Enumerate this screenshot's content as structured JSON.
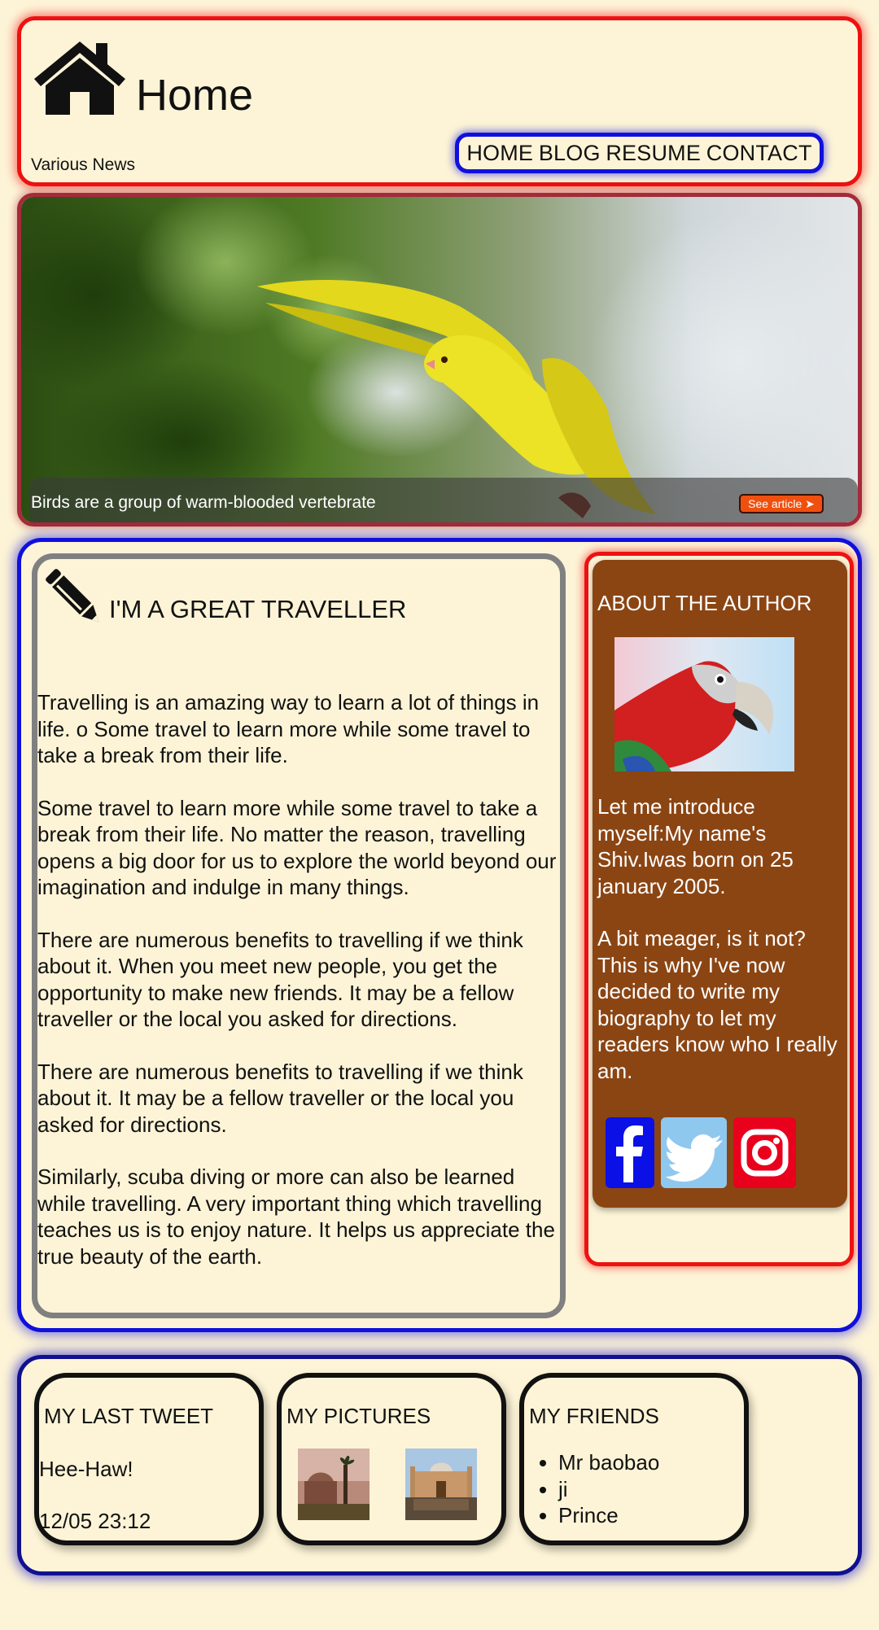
{
  "header": {
    "title": "Home",
    "subtitle": "Various News",
    "nav": [
      "HOME",
      "BLOG",
      "RESUME",
      "CONTACT"
    ]
  },
  "hero": {
    "caption": "Birds are a group of warm-blooded vertebrate",
    "button_label": "See article ➤"
  },
  "article": {
    "title": "I'M A GREAT TRAVELLER",
    "paragraphs": [
      "Travelling is an amazing way to learn a lot of things in life. o Some travel to learn more while some travel to take a break from their life.",
      "Some travel to learn more while some travel to take a break from their life. No matter the reason, travelling opens a big door for us to explore the world beyond our imagination and indulge in many things.",
      "There are numerous benefits to travelling if we think about it. When you meet new people, you get the opportunity to make new friends. It may be a fellow traveller or the local you asked for directions.",
      "There are numerous benefits to travelling if we think about it. It may be a fellow traveller or the local you asked for directions.",
      "Similarly, scuba diving or more can also be learned while travelling. A very important thing which travelling teaches us is to enjoy nature. It helps us appreciate the true beauty of the earth."
    ]
  },
  "author": {
    "title": "ABOUT THE AUTHOR",
    "bio": [
      "Let me introduce myself:My name's Shiv.Iwas born on 25 january 2005.",
      "A bit meager, is it not? This is why I've now decided to write my biography to let my readers know who I really am."
    ],
    "social": [
      "facebook-icon",
      "twitter-icon",
      "instagram-icon"
    ]
  },
  "footer": {
    "tweet": {
      "title": "MY LAST TWEET",
      "text": "Hee-Haw!",
      "time": "12/05 23:12"
    },
    "pictures": {
      "title": "MY PICTURES"
    },
    "friends": {
      "title": "MY FRIENDS",
      "items": [
        "Mr baobao",
        "ji",
        "Prince"
      ]
    }
  },
  "colors": {
    "background": "#fdf4d7",
    "header_border": "#ee1111",
    "nav_border": "#1010dd",
    "author_card": "#8b4513",
    "button": "#f0500f"
  }
}
